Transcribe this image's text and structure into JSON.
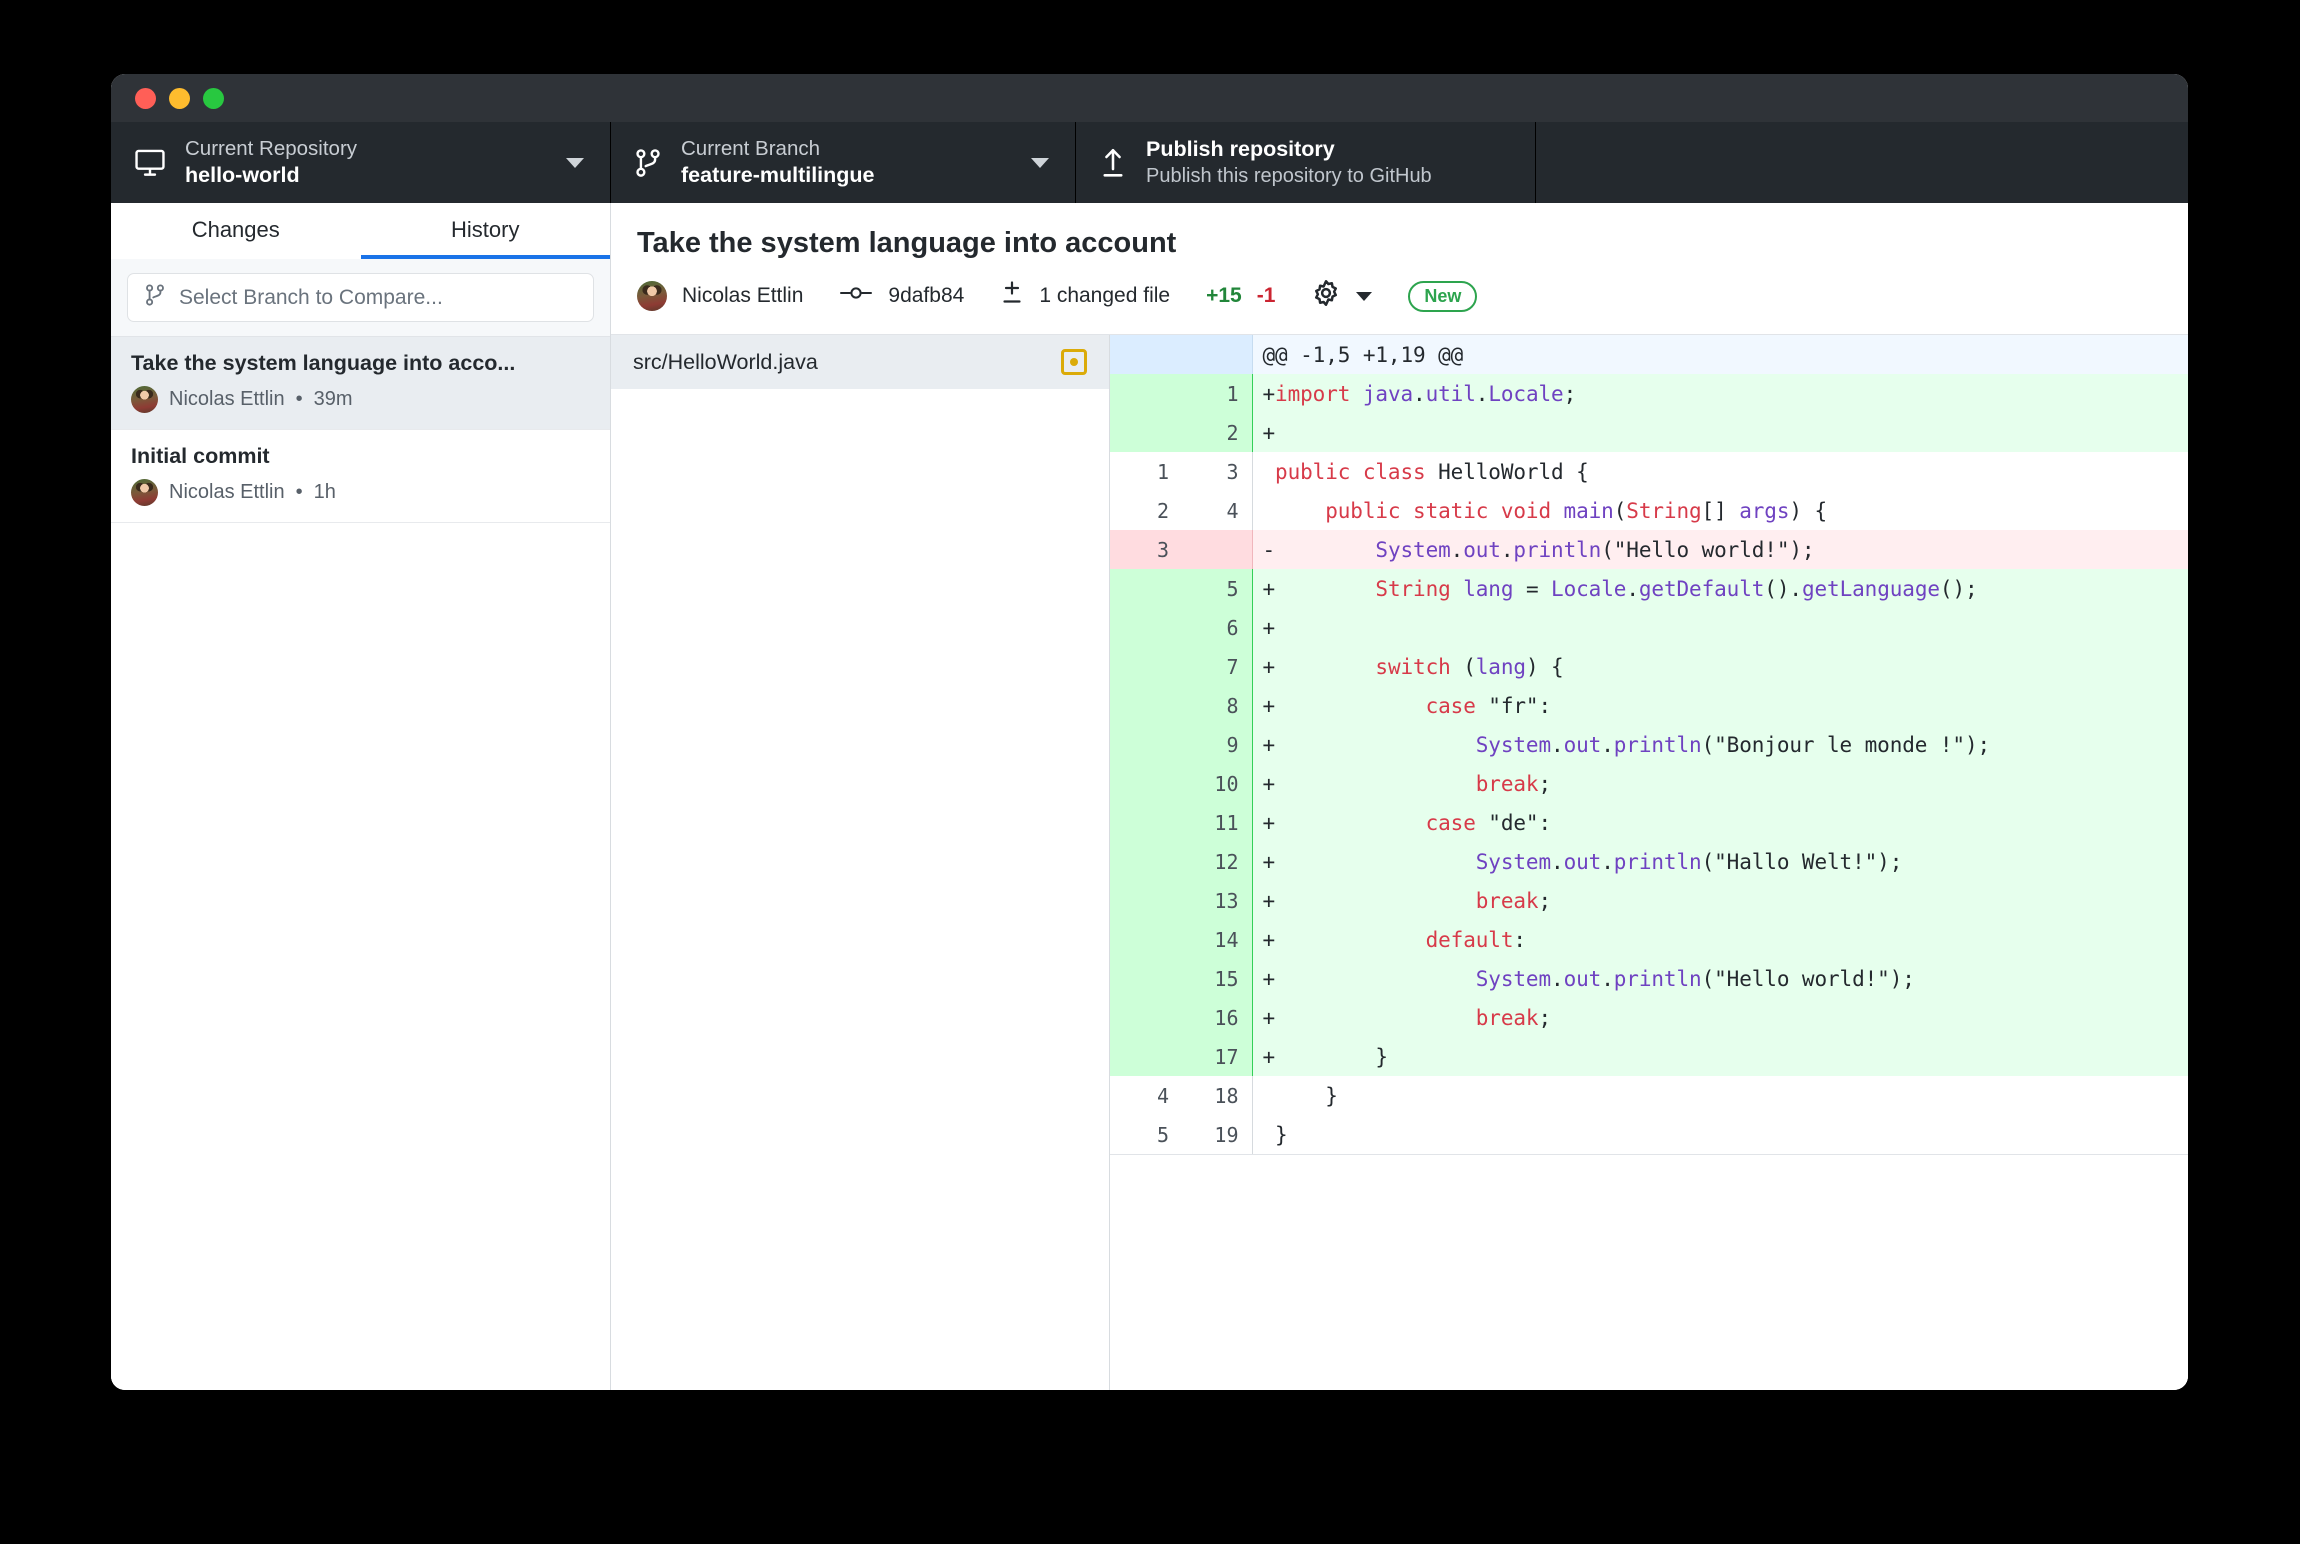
{
  "window": {
    "traffic_lights": [
      "close",
      "minimize",
      "maximize"
    ]
  },
  "toolbar": {
    "repository": {
      "icon": "desktop-icon",
      "label": "Current Repository",
      "value": "hello-world"
    },
    "branch": {
      "icon": "branch-icon",
      "label": "Current Branch",
      "value": "feature-multilingue"
    },
    "publish": {
      "icon": "upload-icon",
      "title": "Publish repository",
      "subtitle": "Publish this repository to GitHub"
    }
  },
  "sidebar": {
    "tabs": [
      {
        "label": "Changes",
        "active": false
      },
      {
        "label": "History",
        "active": true
      }
    ],
    "compare": {
      "icon": "branch-icon",
      "placeholder": "Select Branch to Compare..."
    },
    "commits": [
      {
        "title": "Take the system language into acco...",
        "author": "Nicolas Ettlin",
        "separator": "•",
        "time": "39m",
        "selected": true
      },
      {
        "title": "Initial commit",
        "author": "Nicolas Ettlin",
        "separator": "•",
        "time": "1h",
        "selected": false
      }
    ]
  },
  "commit_header": {
    "summary": "Take the system language into account",
    "author": "Nicolas Ettlin",
    "sha": "9dafb84",
    "changed_files": "1 changed file",
    "additions": "+15",
    "deletions": "-1",
    "gear_icon": "gear-icon",
    "caret_icon": "chevron-down-icon",
    "badge": "New"
  },
  "file_list": {
    "files": [
      {
        "path": "src/HelloWorld.java",
        "status": "modified",
        "selected": true
      }
    ]
  },
  "diff": {
    "rows": [
      {
        "type": "hunk",
        "old": "",
        "new": "",
        "marker": "",
        "tokens": [
          {
            "t": "@@ -1,5 +1,19 @@",
            "c": "pl"
          }
        ]
      },
      {
        "type": "add",
        "old": "",
        "new": "1",
        "marker": "+",
        "tokens": [
          {
            "t": "import ",
            "c": "kw"
          },
          {
            "t": "java",
            "c": "id"
          },
          {
            "t": ".",
            "c": "pl"
          },
          {
            "t": "util",
            "c": "id"
          },
          {
            "t": ".",
            "c": "pl"
          },
          {
            "t": "Locale",
            "c": "id"
          },
          {
            "t": ";",
            "c": "pl"
          }
        ]
      },
      {
        "type": "add",
        "old": "",
        "new": "2",
        "marker": "+",
        "tokens": [
          {
            "t": "",
            "c": "pl"
          }
        ]
      },
      {
        "type": "ctx",
        "old": "1",
        "new": "3",
        "marker": " ",
        "tokens": [
          {
            "t": "public class ",
            "c": "kw"
          },
          {
            "t": "HelloWorld {",
            "c": "pl"
          }
        ]
      },
      {
        "type": "ctx",
        "old": "2",
        "new": "4",
        "marker": " ",
        "tokens": [
          {
            "t": "    public static void ",
            "c": "kw"
          },
          {
            "t": "main",
            "c": "id"
          },
          {
            "t": "(",
            "c": "pl"
          },
          {
            "t": "String",
            "c": "kw"
          },
          {
            "t": "[] ",
            "c": "pl"
          },
          {
            "t": "args",
            "c": "id"
          },
          {
            "t": ") {",
            "c": "pl"
          }
        ]
      },
      {
        "type": "del",
        "old": "3",
        "new": "",
        "marker": "-",
        "tokens": [
          {
            "t": "        ",
            "c": "pl"
          },
          {
            "t": "System",
            "c": "id"
          },
          {
            "t": ".",
            "c": "pl"
          },
          {
            "t": "out",
            "c": "id"
          },
          {
            "t": ".",
            "c": "pl"
          },
          {
            "t": "println",
            "c": "id"
          },
          {
            "t": "(\"Hello world!\");",
            "c": "str"
          }
        ]
      },
      {
        "type": "add",
        "old": "",
        "new": "5",
        "marker": "+",
        "tokens": [
          {
            "t": "        ",
            "c": "pl"
          },
          {
            "t": "String ",
            "c": "kw"
          },
          {
            "t": "lang",
            "c": "id"
          },
          {
            "t": " = ",
            "c": "pl"
          },
          {
            "t": "Locale",
            "c": "id"
          },
          {
            "t": ".",
            "c": "pl"
          },
          {
            "t": "getDefault",
            "c": "id"
          },
          {
            "t": "().",
            "c": "pl"
          },
          {
            "t": "getLanguage",
            "c": "id"
          },
          {
            "t": "();",
            "c": "pl"
          }
        ]
      },
      {
        "type": "add",
        "old": "",
        "new": "6",
        "marker": "+",
        "tokens": [
          {
            "t": "",
            "c": "pl"
          }
        ]
      },
      {
        "type": "add",
        "old": "",
        "new": "7",
        "marker": "+",
        "tokens": [
          {
            "t": "        ",
            "c": "pl"
          },
          {
            "t": "switch ",
            "c": "kw"
          },
          {
            "t": "(",
            "c": "pl"
          },
          {
            "t": "lang",
            "c": "id"
          },
          {
            "t": ") {",
            "c": "pl"
          }
        ]
      },
      {
        "type": "add",
        "old": "",
        "new": "8",
        "marker": "+",
        "tokens": [
          {
            "t": "            ",
            "c": "pl"
          },
          {
            "t": "case ",
            "c": "kw"
          },
          {
            "t": "\"fr\":",
            "c": "str"
          }
        ]
      },
      {
        "type": "add",
        "old": "",
        "new": "9",
        "marker": "+",
        "tokens": [
          {
            "t": "                ",
            "c": "pl"
          },
          {
            "t": "System",
            "c": "id"
          },
          {
            "t": ".",
            "c": "pl"
          },
          {
            "t": "out",
            "c": "id"
          },
          {
            "t": ".",
            "c": "pl"
          },
          {
            "t": "println",
            "c": "id"
          },
          {
            "t": "(\"Bonjour le monde !\");",
            "c": "str"
          }
        ]
      },
      {
        "type": "add",
        "old": "",
        "new": "10",
        "marker": "+",
        "tokens": [
          {
            "t": "                ",
            "c": "pl"
          },
          {
            "t": "break",
            "c": "kw"
          },
          {
            "t": ";",
            "c": "pl"
          }
        ]
      },
      {
        "type": "add",
        "old": "",
        "new": "11",
        "marker": "+",
        "tokens": [
          {
            "t": "            ",
            "c": "pl"
          },
          {
            "t": "case ",
            "c": "kw"
          },
          {
            "t": "\"de\":",
            "c": "str"
          }
        ]
      },
      {
        "type": "add",
        "old": "",
        "new": "12",
        "marker": "+",
        "tokens": [
          {
            "t": "                ",
            "c": "pl"
          },
          {
            "t": "System",
            "c": "id"
          },
          {
            "t": ".",
            "c": "pl"
          },
          {
            "t": "out",
            "c": "id"
          },
          {
            "t": ".",
            "c": "pl"
          },
          {
            "t": "println",
            "c": "id"
          },
          {
            "t": "(\"Hallo Welt!\");",
            "c": "str"
          }
        ]
      },
      {
        "type": "add",
        "old": "",
        "new": "13",
        "marker": "+",
        "tokens": [
          {
            "t": "                ",
            "c": "pl"
          },
          {
            "t": "break",
            "c": "kw"
          },
          {
            "t": ";",
            "c": "pl"
          }
        ]
      },
      {
        "type": "add",
        "old": "",
        "new": "14",
        "marker": "+",
        "tokens": [
          {
            "t": "            ",
            "c": "pl"
          },
          {
            "t": "default",
            "c": "kw"
          },
          {
            "t": ":",
            "c": "pl"
          }
        ]
      },
      {
        "type": "add",
        "old": "",
        "new": "15",
        "marker": "+",
        "tokens": [
          {
            "t": "                ",
            "c": "pl"
          },
          {
            "t": "System",
            "c": "id"
          },
          {
            "t": ".",
            "c": "pl"
          },
          {
            "t": "out",
            "c": "id"
          },
          {
            "t": ".",
            "c": "pl"
          },
          {
            "t": "println",
            "c": "id"
          },
          {
            "t": "(\"Hello world!\");",
            "c": "str"
          }
        ]
      },
      {
        "type": "add",
        "old": "",
        "new": "16",
        "marker": "+",
        "tokens": [
          {
            "t": "                ",
            "c": "pl"
          },
          {
            "t": "break",
            "c": "kw"
          },
          {
            "t": ";",
            "c": "pl"
          }
        ]
      },
      {
        "type": "add",
        "old": "",
        "new": "17",
        "marker": "+",
        "tokens": [
          {
            "t": "        }",
            "c": "pl"
          }
        ]
      },
      {
        "type": "ctx",
        "old": "4",
        "new": "18",
        "marker": " ",
        "tokens": [
          {
            "t": "    }",
            "c": "pl"
          }
        ]
      },
      {
        "type": "ctx",
        "old": "5",
        "new": "19",
        "marker": " ",
        "tokens": [
          {
            "t": "}",
            "c": "pl"
          }
        ]
      }
    ]
  },
  "colors": {
    "toolbar_bg": "#24292e",
    "titlebar_bg": "#2f3338",
    "accent_blue": "#1a73e8",
    "added_bg": "#e6ffed",
    "added_gutter": "#cdffd8",
    "deleted_bg": "#ffeef0",
    "deleted_gutter": "#ffdce0",
    "hunk_bg": "#f1f8ff",
    "hunk_gutter": "#dbedff",
    "additions_text": "#22863a",
    "deletions_text": "#cb2431",
    "badge_green": "#2da44e",
    "modified_yellow": "#dbab09",
    "keyword": "#d73a49",
    "identifier": "#6f42c1"
  }
}
